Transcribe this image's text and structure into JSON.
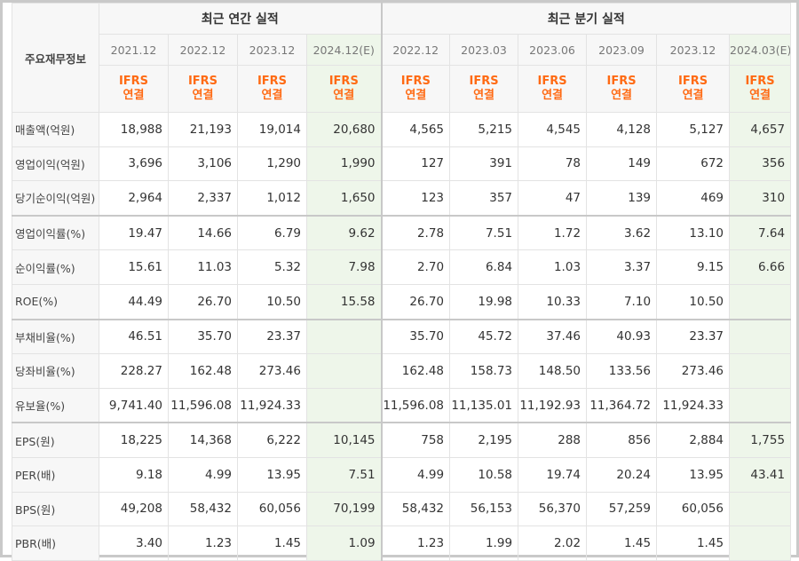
{
  "header": {
    "corner_label": "주요재무정보",
    "annual_group": "최근 연간 실적",
    "quarter_group": "최근 분기 실적",
    "periods": [
      "2021.12",
      "2022.12",
      "2023.12",
      "2024.12(E)",
      "2022.12",
      "2023.03",
      "2023.06",
      "2023.09",
      "2023.12",
      "2024.03(E)"
    ],
    "acct_line1": "IFRS",
    "acct_line2": "연결"
  },
  "rows": [
    {
      "label": "매출액(억원)",
      "values": [
        "18,988",
        "21,193",
        "19,014",
        "20,680",
        "4,565",
        "5,215",
        "4,545",
        "4,128",
        "5,127",
        "4,657"
      ]
    },
    {
      "label": "영업이익(억원)",
      "values": [
        "3,696",
        "3,106",
        "1,290",
        "1,990",
        "127",
        "391",
        "78",
        "149",
        "672",
        "356"
      ]
    },
    {
      "label": "당기순이익(억원)",
      "values": [
        "2,964",
        "2,337",
        "1,012",
        "1,650",
        "123",
        "357",
        "47",
        "139",
        "469",
        "310"
      ]
    },
    {
      "label": "영업이익률(%)",
      "values": [
        "19.47",
        "14.66",
        "6.79",
        "9.62",
        "2.78",
        "7.51",
        "1.72",
        "3.62",
        "13.10",
        "7.64"
      ]
    },
    {
      "label": "순이익률(%)",
      "values": [
        "15.61",
        "11.03",
        "5.32",
        "7.98",
        "2.70",
        "6.84",
        "1.03",
        "3.37",
        "9.15",
        "6.66"
      ]
    },
    {
      "label": "ROE(%)",
      "values": [
        "44.49",
        "26.70",
        "10.50",
        "15.58",
        "26.70",
        "19.98",
        "10.33",
        "7.10",
        "10.50",
        ""
      ]
    },
    {
      "label": "부채비율(%)",
      "values": [
        "46.51",
        "35.70",
        "23.37",
        "",
        "35.70",
        "45.72",
        "37.46",
        "40.93",
        "23.37",
        ""
      ]
    },
    {
      "label": "당좌비율(%)",
      "values": [
        "228.27",
        "162.48",
        "273.46",
        "",
        "162.48",
        "158.73",
        "148.50",
        "133.56",
        "273.46",
        ""
      ]
    },
    {
      "label": "유보율(%)",
      "values": [
        "9,741.40",
        "11,596.08",
        "11,924.33",
        "",
        "11,596.08",
        "11,135.01",
        "11,192.93",
        "11,364.72",
        "11,924.33",
        ""
      ]
    },
    {
      "label": "EPS(원)",
      "values": [
        "18,225",
        "14,368",
        "6,222",
        "10,145",
        "758",
        "2,195",
        "288",
        "856",
        "2,884",
        "1,755"
      ]
    },
    {
      "label": "PER(배)",
      "values": [
        "9.18",
        "4.99",
        "13.95",
        "7.51",
        "4.99",
        "10.58",
        "19.74",
        "20.24",
        "13.95",
        "43.41"
      ]
    },
    {
      "label": "BPS(원)",
      "values": [
        "49,208",
        "58,432",
        "60,056",
        "70,199",
        "58,432",
        "56,153",
        "56,370",
        "57,259",
        "60,056",
        ""
      ]
    },
    {
      "label": "PBR(배)",
      "values": [
        "3.40",
        "1.23",
        "1.45",
        "1.09",
        "1.23",
        "1.99",
        "2.02",
        "1.45",
        "1.45",
        ""
      ]
    }
  ]
}
